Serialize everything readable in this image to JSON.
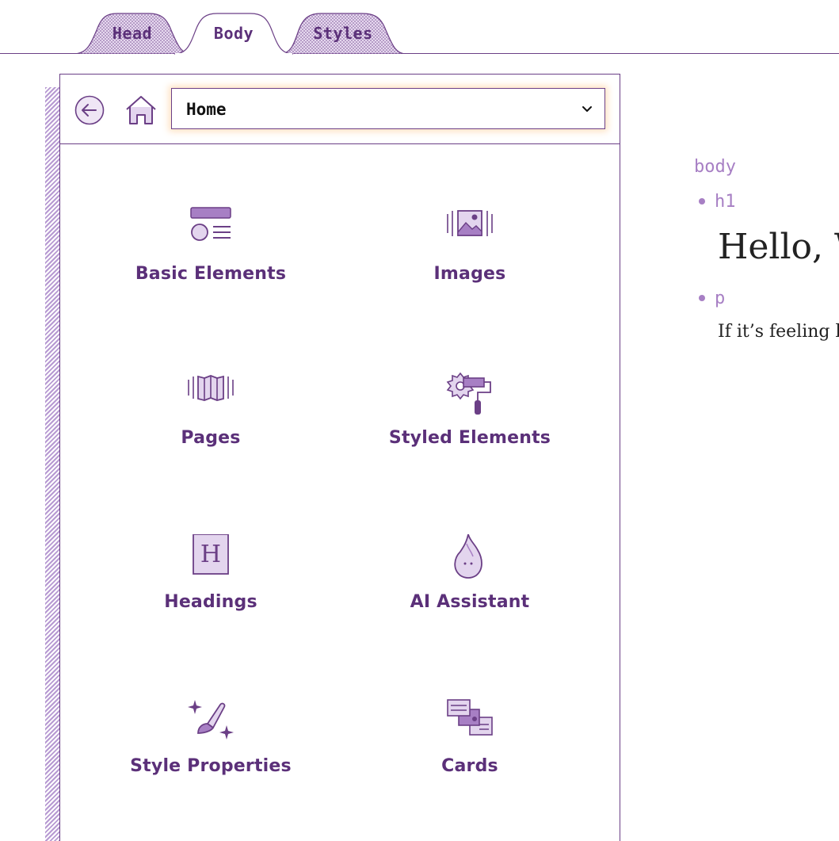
{
  "tabs": [
    {
      "label": "Head",
      "active": false
    },
    {
      "label": "Body",
      "active": true
    },
    {
      "label": "Styles",
      "active": false
    }
  ],
  "toolbar": {
    "back_icon": "back-arrow-icon",
    "home_icon": "home-icon",
    "select_value": "Home"
  },
  "items": [
    {
      "label": "Basic Elements",
      "icon": "basic-elements-icon"
    },
    {
      "label": "Images",
      "icon": "images-icon"
    },
    {
      "label": "Pages",
      "icon": "pages-icon"
    },
    {
      "label": "Styled Elements",
      "icon": "styled-elements-icon"
    },
    {
      "label": "Headings",
      "icon": "headings-icon"
    },
    {
      "label": "AI Assistant",
      "icon": "ai-assistant-icon"
    },
    {
      "label": "Style Properties",
      "icon": "style-properties-icon"
    },
    {
      "label": "Cards",
      "icon": "cards-icon"
    }
  ],
  "preview": {
    "root_tag": "body",
    "h1_tag": "h1",
    "h1_text": "Hello, W",
    "p_tag": "p",
    "p_text": "If it’s feeling l"
  },
  "colors": {
    "accent": "#5b3079",
    "accent_light": "#a77fc4",
    "line": "#6b3f86"
  }
}
